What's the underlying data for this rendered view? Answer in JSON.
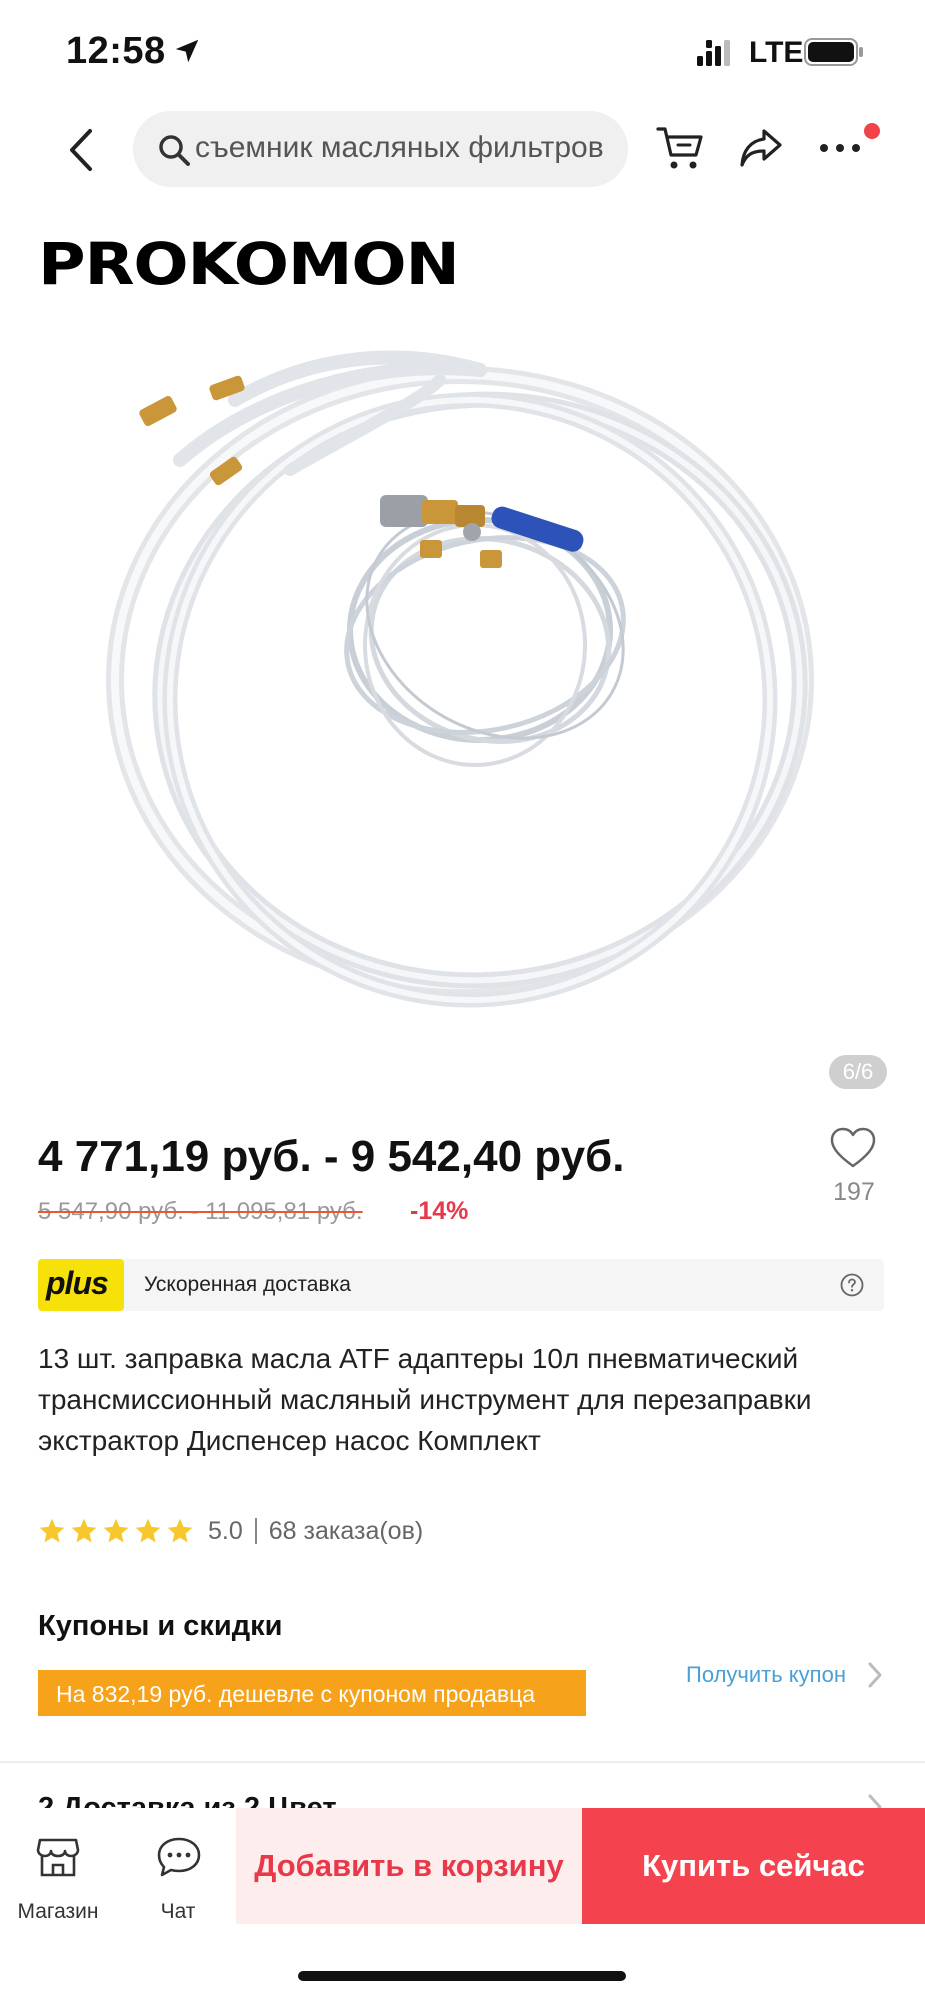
{
  "status_bar": {
    "time": "12:58",
    "network": "LTE"
  },
  "nav": {
    "search_text": "съемник масляных фильтров",
    "icons": [
      "back-icon",
      "search-icon",
      "cart-icon",
      "share-icon",
      "more-icon"
    ]
  },
  "product": {
    "brand": "PROKOMON",
    "image_counter": "6/6",
    "price_range": "4 771,19 руб. - 9 542,40 руб.",
    "old_price": "5 547,90 руб. - 11 095,81 руб.",
    "discount": "-14%",
    "wishlist_count": "197",
    "plus_badge": "plus",
    "plus_text": "Ускоренная доставка",
    "title": "13 шт. заправка масла ATF адаптеры 10л пневматический трансмиссионный масляный инструмент для перезаправки экстрактор Диспенсер насос Комплект",
    "rating": "5.0",
    "rating_stars": 5,
    "orders": "68 заказа(ов)"
  },
  "coupons": {
    "title": "Купоны и скидки",
    "strip_text": "На 832,19 руб. дешевле с купоном продавца",
    "get_coupon": "Получить купон"
  },
  "next_section": {
    "label": "2 Доставка из 2 Цвет"
  },
  "bottom_bar": {
    "store_label": "Магазин",
    "chat_label": "Чат",
    "add_to_cart": "Добавить в корзину",
    "buy_now": "Купить сейчас"
  },
  "colors": {
    "accent_red": "#f5424f",
    "coupon_orange": "#f7a21b",
    "plus_yellow": "#f6e20a",
    "link_blue": "#4b9fd8",
    "star_yellow": "#f7c72b"
  }
}
